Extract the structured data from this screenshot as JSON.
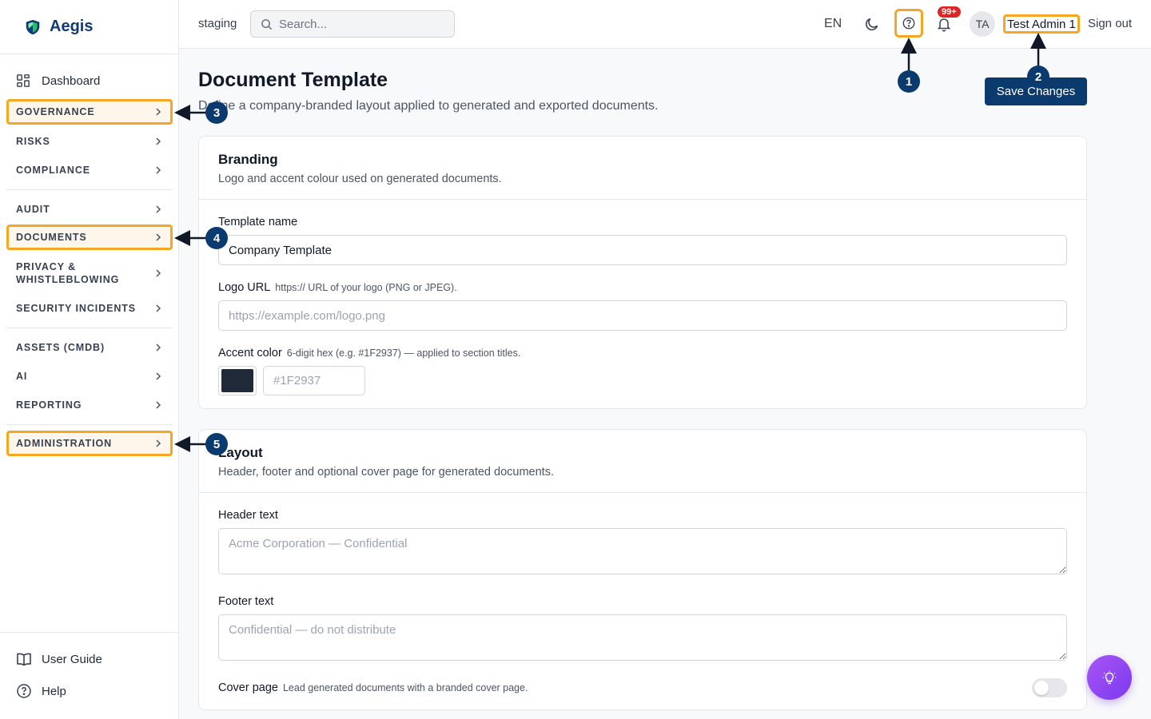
{
  "app": {
    "name": "Aegis",
    "environment": "staging"
  },
  "colors": {
    "brand": "#0b3a6e",
    "highlight": "#f5a623",
    "accent_default": "#1F2937",
    "assistant": "#7c3aed"
  },
  "sidebar": {
    "dashboard": "Dashboard",
    "items": [
      {
        "label": "GOVERNANCE"
      },
      {
        "label": "RISKS"
      },
      {
        "label": "COMPLIANCE"
      },
      {
        "label": "AUDIT"
      },
      {
        "label": "DOCUMENTS"
      },
      {
        "label": "PRIVACY & WHISTLEBLOWING"
      },
      {
        "label": "SECURITY INCIDENTS"
      },
      {
        "label": "ASSETS (CMDB)"
      },
      {
        "label": "AI"
      },
      {
        "label": "REPORTING"
      },
      {
        "label": "ADMINISTRATION"
      }
    ],
    "footer": {
      "user_guide": "User Guide",
      "help": "Help"
    }
  },
  "topbar": {
    "search_placeholder": "Search...",
    "language": "EN",
    "notifications_badge": "99+",
    "avatar_initials": "TA",
    "user_name": "Test Admin 1",
    "sign_out": "Sign out"
  },
  "page": {
    "title": "Document Template",
    "subtitle": "Define a company-branded layout applied to generated and exported documents.",
    "save_button": "Save Changes"
  },
  "branding": {
    "title": "Branding",
    "description": "Logo and accent colour used on generated documents.",
    "template_name_label": "Template name",
    "template_name_value": "Company Template",
    "logo_url_label": "Logo URL",
    "logo_url_hint": "https:// URL of your logo (PNG or JPEG).",
    "logo_url_placeholder": "https://example.com/logo.png",
    "accent_label": "Accent color",
    "accent_hint": "6-digit hex (e.g. #1F2937) — applied to section titles.",
    "accent_placeholder": "#1F2937"
  },
  "layout": {
    "title": "Layout",
    "description": "Header, footer and optional cover page for generated documents.",
    "header_label": "Header text",
    "header_placeholder": "Acme Corporation — Confidential",
    "footer_label": "Footer text",
    "footer_placeholder": "Confidential — do not distribute",
    "cover_label": "Cover page",
    "cover_hint": "Lead generated documents with a branded cover page.",
    "cover_enabled": false
  },
  "annotations": [
    "1",
    "2",
    "3",
    "4",
    "5"
  ]
}
